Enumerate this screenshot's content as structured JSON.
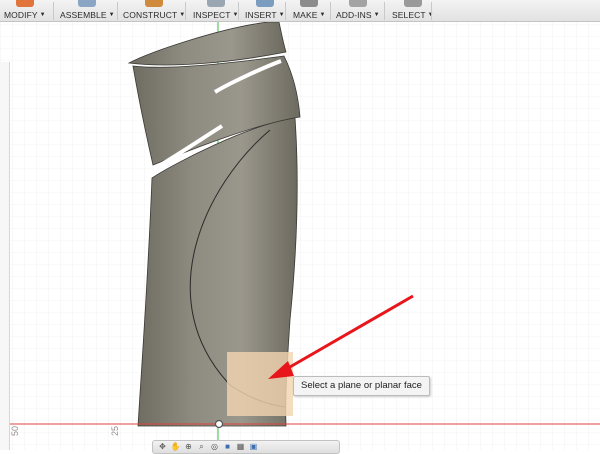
{
  "toolbar": {
    "menus": [
      {
        "label": "MODIFY",
        "icon": "modify-icon",
        "color": "#e0743a"
      },
      {
        "label": "ASSEMBLE",
        "icon": "assemble-icon",
        "color": "#8ba6c4"
      },
      {
        "label": "CONSTRUCT",
        "icon": "construct-icon",
        "color": "#d08a3c"
      },
      {
        "label": "INSPECT",
        "icon": "inspect-icon",
        "color": "#9aa7b3"
      },
      {
        "label": "INSERT",
        "icon": "insert-icon",
        "color": "#7b9dc0"
      },
      {
        "label": "MAKE",
        "icon": "make-icon",
        "color": "#8c8c8c"
      },
      {
        "label": "ADD-INS",
        "icon": "add-ins-icon",
        "color": "#a3a3a3"
      },
      {
        "label": "SELECT",
        "icon": "select-icon",
        "color": "#9a9a9a"
      }
    ]
  },
  "viewport": {
    "tooltip": "Select a plane or planar face",
    "ruler_labels": [
      "50",
      "25"
    ],
    "colors": {
      "model": "#7d7a6e",
      "selection_plane": "#f3d5b0",
      "arrow": "#e8161b",
      "axis_green": "#3ebd4a",
      "axis_red": "#e0413b"
    }
  },
  "navbar": {
    "buttons": [
      "orbit-icon",
      "pan-icon",
      "zoom-icon",
      "fit-icon",
      "look-at-icon",
      "display-mode-icon",
      "grid-icon",
      "viewports-icon"
    ]
  }
}
